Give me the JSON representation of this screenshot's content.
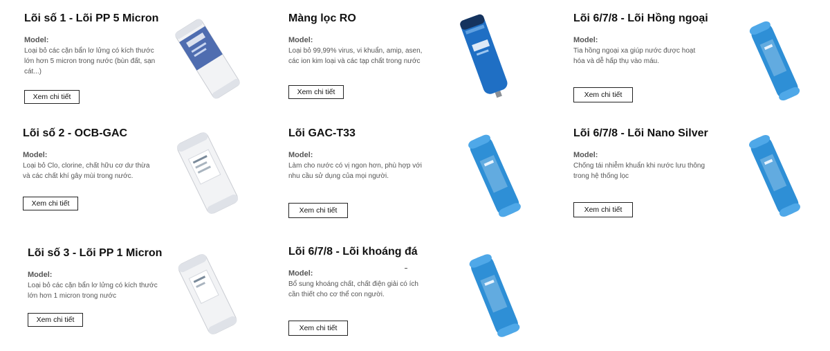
{
  "products": [
    {
      "title": "Lõi số 1 - Lõi PP 5 Micron",
      "model_label": "Model:",
      "description": "Loại bỏ các cặn bẩn lơ lửng có kích thước lớn hơn 5 micron trong nước (bùn đất, sạn cát...)",
      "button_label": "Xem chi tiết",
      "image": "white-pp-filter-cartridge"
    },
    {
      "title": "Màng lọc RO",
      "model_label": "Model:",
      "description": "Loại bỏ 99,99% virus, vi khuẩn, amip, asen, các ion kim loại và các tạp chất trong nước",
      "button_label": "Xem chi tiết",
      "image": "ro-membrane"
    },
    {
      "title": "Lõi 6/7/8 - Lõi Hồng ngoại",
      "model_label": "Model:",
      "description": "Tia hồng ngoại xa giúp nước được hoạt hóa và dễ hấp thụ vào máu.",
      "button_label": "Xem chi tiết",
      "image": "blue-inline-filter-cartridge"
    },
    {
      "title": "Lõi số 2 - OCB-GAC",
      "model_label": "Model:",
      "description": "Loại bỏ Clo, clorine, chất hữu cơ dư thừa và các chất khí gây mùi trong nước.",
      "button_label": "Xem chi tiết",
      "image": "white-carbon-filter-cartridge"
    },
    {
      "title": "Lõi GAC-T33",
      "model_label": "Model:",
      "description": "Làm cho nước có vị ngon hơn, phù hợp với nhu cầu sử dụng của mọi người.",
      "button_label": "Xem chi tiết",
      "image": "blue-inline-filter-cartridge"
    },
    {
      "title": "Lõi 6/7/8 - Lõi Nano Silver",
      "model_label": "Model:",
      "description": "Chống tái nhiễm khuẩn khi nước lưu thông trong hệ thống lọc",
      "button_label": "Xem chi tiết",
      "image": "blue-inline-filter-cartridge"
    },
    {
      "title": "Lõi số 3 - Lõi PP 1 Micron",
      "model_label": "Model:",
      "description": "Loại bỏ các cặn bẩn lơ lửng có kích thước lớn hơn 1 micron trong nước",
      "button_label": "Xem chi tiết",
      "image": "white-pp-filter-cartridge"
    },
    {
      "title": "Lõi 6/7/8 - Lõi khoáng đá",
      "model_label": "Model:",
      "description": "Bổ sung khoáng chất, chất điện giải có ích cần thiết cho cơ thể con người.",
      "button_label": "Xem chi tiết",
      "image": "blue-inline-filter-cartridge"
    }
  ],
  "colors": {
    "cartridge_blue": "#2e8fd6",
    "membrane_blue": "#1f6fc4",
    "white_cartridge": "#f2f3f5"
  }
}
